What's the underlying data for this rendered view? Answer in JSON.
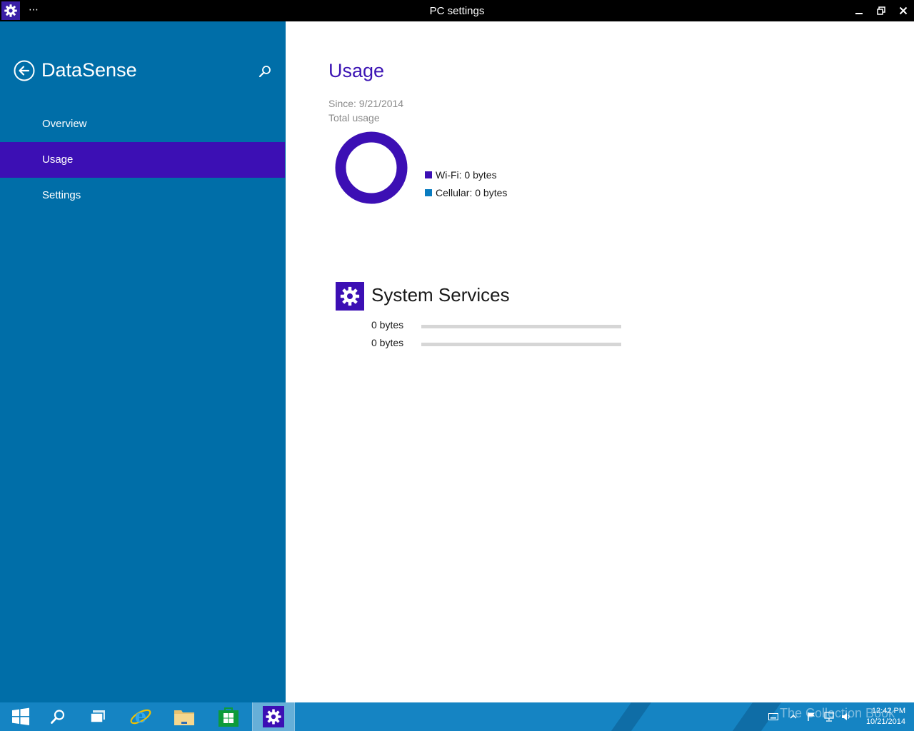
{
  "window": {
    "title": "PC settings",
    "menu_glyph": "⋯"
  },
  "nav": {
    "title": "DataSense",
    "items": [
      {
        "label": "Overview",
        "selected": false
      },
      {
        "label": "Usage",
        "selected": true
      },
      {
        "label": "Settings",
        "selected": false
      }
    ]
  },
  "usage": {
    "title": "Usage",
    "since": "Since: 9/21/2014",
    "total_label": "Total usage",
    "legend": [
      {
        "label": "Wi-Fi: 0 bytes",
        "color": "#3c0fb4"
      },
      {
        "label": "Cellular: 0 bytes",
        "color": "#0a7cc0"
      }
    ]
  },
  "services": [
    {
      "name": "System Services",
      "icon": "gear-icon",
      "rows": [
        {
          "value": "0 bytes",
          "fraction": 0
        },
        {
          "value": "0 bytes",
          "fraction": 0
        }
      ]
    }
  ],
  "taskbar": {
    "apps": [
      "start-icon",
      "search-icon",
      "task-view-icon",
      "internet-explorer-icon",
      "file-explorer-icon",
      "store-icon",
      "pc-settings-icon"
    ],
    "active_app": "pc-settings-icon",
    "tray": [
      "keyboard-icon",
      "show-hidden-icons",
      "action-center-flag-icon",
      "network-icon",
      "volume-icon"
    ],
    "time": "12:42 PM",
    "date": "10/21/2014",
    "watermark": "The Collection Book"
  },
  "colors": {
    "nav_bg": "#006ea8",
    "selected_bg": "#3c0fb4",
    "accent": "#3c14b4",
    "taskbar_bg": "#1584c3"
  }
}
